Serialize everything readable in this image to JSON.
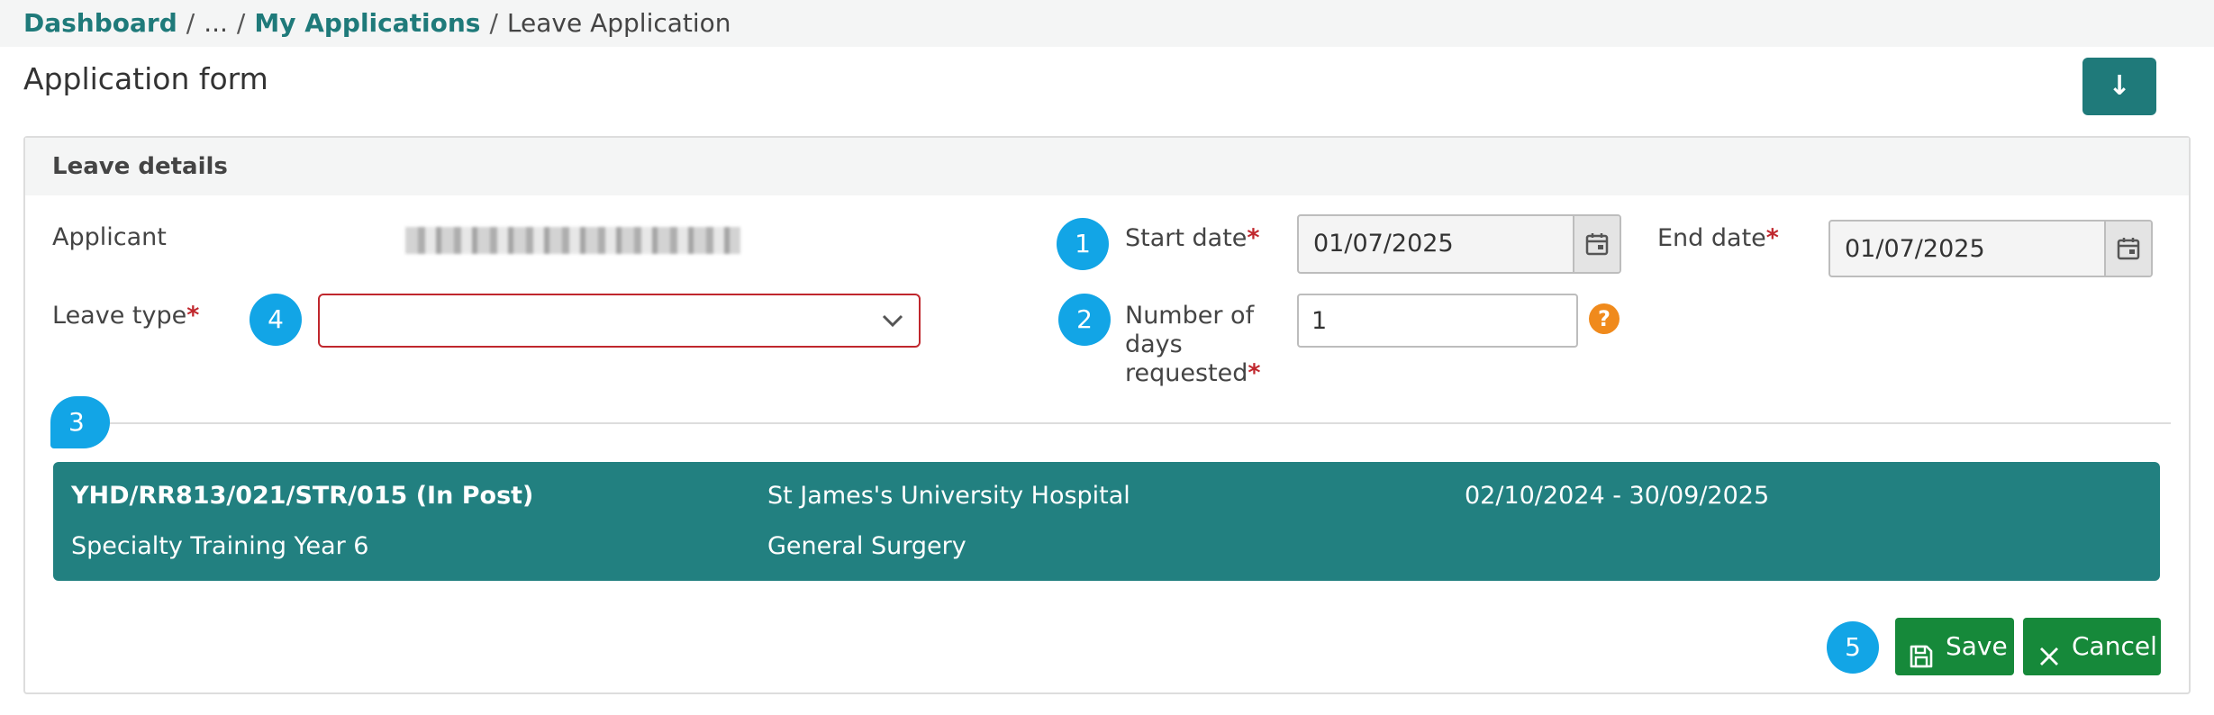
{
  "breadcrumb": {
    "items": [
      "Dashboard",
      "...",
      "My Applications",
      "Leave Application"
    ],
    "separator": "/"
  },
  "page": {
    "title": "Application form",
    "download_icon": "↓"
  },
  "panel": {
    "title": "Leave details"
  },
  "form": {
    "applicant_label": "Applicant",
    "start_date": {
      "label": "Start date",
      "required_mark": "*",
      "value": "01/07/2025"
    },
    "end_date": {
      "label": "End date",
      "required_mark": "*",
      "value": "01/07/2025"
    },
    "leave_type": {
      "label": "Leave type",
      "required_mark": "*",
      "value": ""
    },
    "days_requested": {
      "label_lines": [
        "Number of",
        "days",
        "requested"
      ],
      "required_mark": "*",
      "value": "1",
      "help_icon": "?"
    }
  },
  "badges": [
    "1",
    "2",
    "3",
    "4",
    "5"
  ],
  "post": {
    "reference": "YHD/RR813/021/STR/015 (In Post)",
    "grade": "Specialty Training Year 6",
    "site": "St James's University Hospital",
    "specialty": "General Surgery",
    "period": "02/10/2024 - 30/09/2025"
  },
  "actions": {
    "save_label": "Save",
    "cancel_label": "Cancel"
  },
  "colors": {
    "accent": "#1f7a7a",
    "card": "#228080",
    "badge": "#12a5e6",
    "button": "#16893a",
    "required": "#c0272d",
    "help": "#f08a1c"
  },
  "icons": {
    "calendar": "calendar-icon",
    "chevron": "chevron-down-icon",
    "save": "floppy-disk-icon",
    "cancel": "close-icon",
    "download": "download-icon"
  }
}
